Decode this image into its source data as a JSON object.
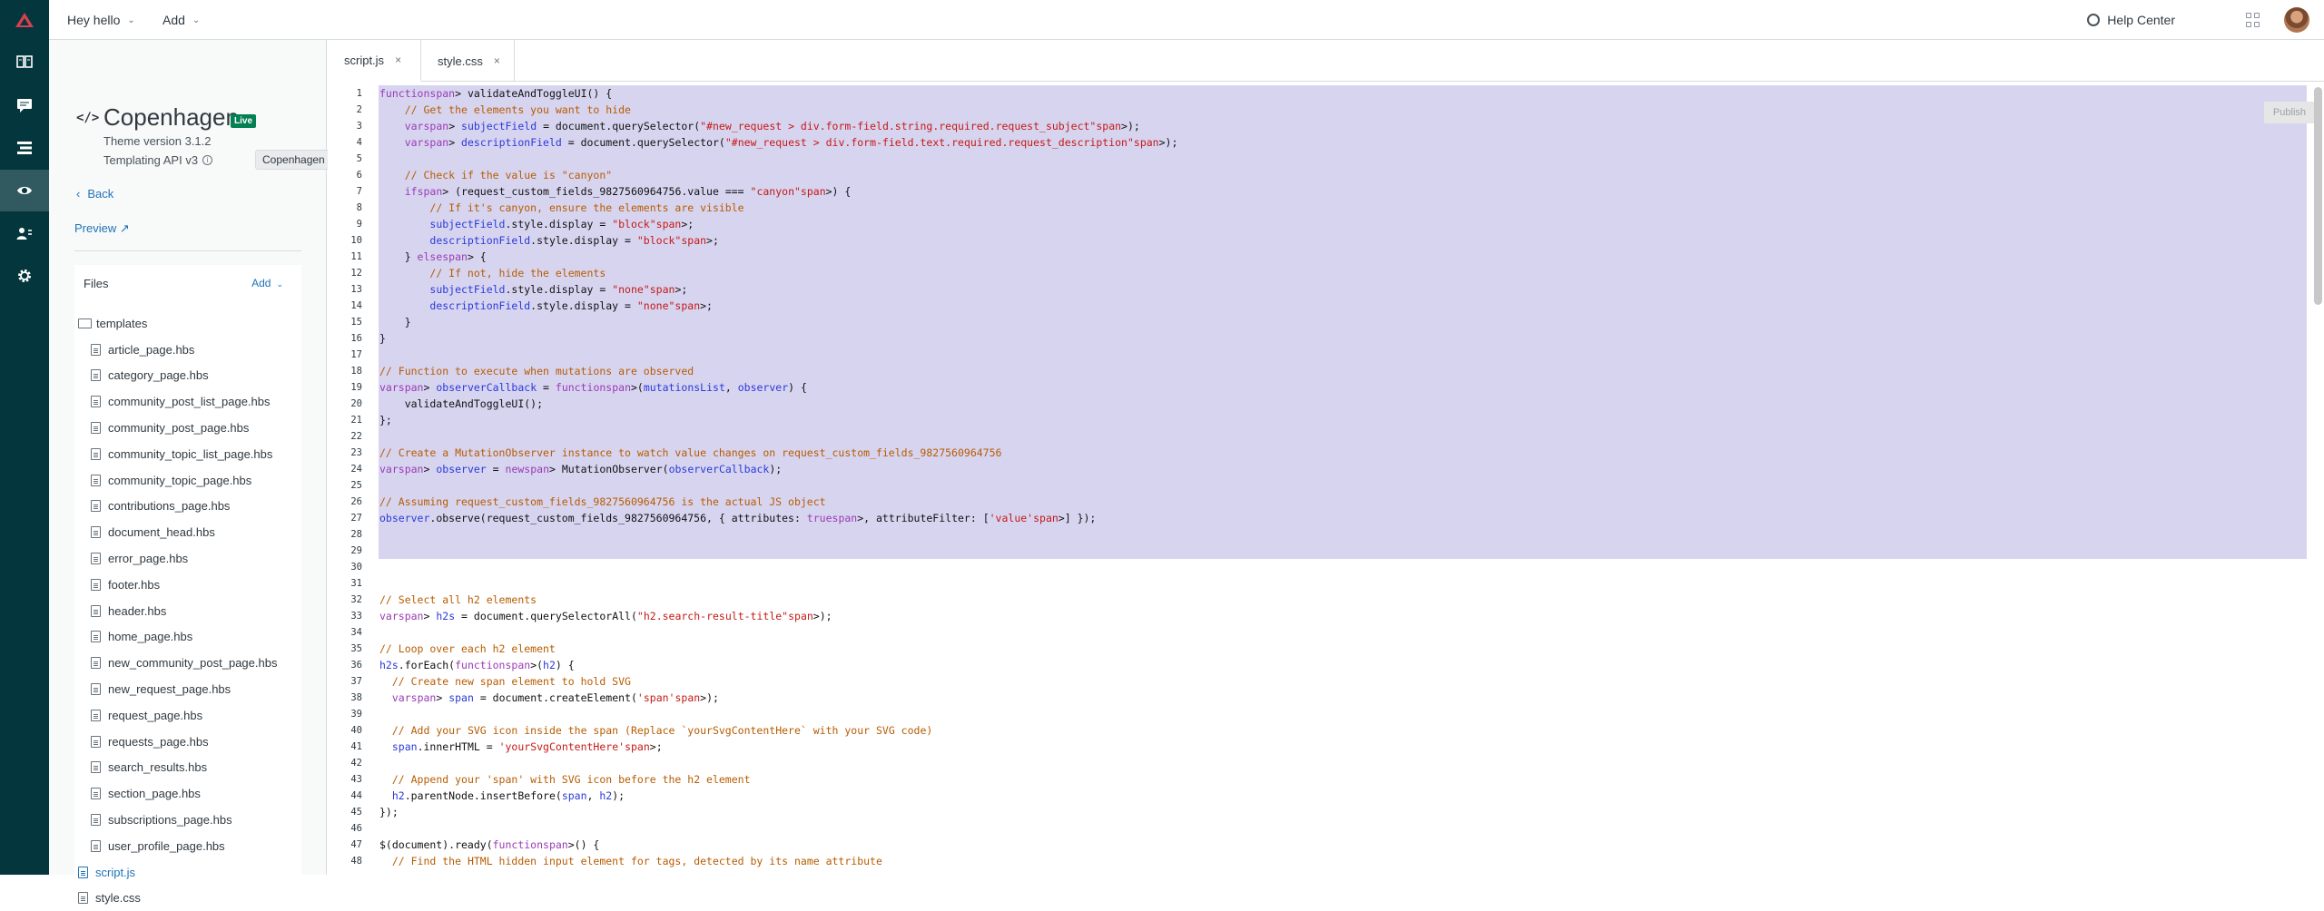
{
  "topbar": {
    "greeting": "Hey hello",
    "add": "Add",
    "help": "Help Center"
  },
  "rail": {
    "items": [
      "guide-icon",
      "chat-icon",
      "list-icon",
      "eye-icon",
      "users-icon",
      "gear-icon"
    ]
  },
  "theme": {
    "name": "Copenhagen",
    "status": "Live",
    "version": "Theme version 3.1.2",
    "api": "Templating API v3",
    "back": "Back",
    "preview": "Preview",
    "tooltip": "Copenhagen"
  },
  "files": {
    "title": "Files",
    "add": "Add",
    "folder": "templates",
    "templates": [
      "article_page.hbs",
      "category_page.hbs",
      "community_post_list_page.hbs",
      "community_post_page.hbs",
      "community_topic_list_page.hbs",
      "community_topic_page.hbs",
      "contributions_page.hbs",
      "document_head.hbs",
      "error_page.hbs",
      "footer.hbs",
      "header.hbs",
      "home_page.hbs",
      "new_community_post_page.hbs",
      "new_request_page.hbs",
      "request_page.hbs",
      "requests_page.hbs",
      "search_results.hbs",
      "section_page.hbs",
      "subscriptions_page.hbs",
      "user_profile_page.hbs"
    ],
    "root": [
      "script.js",
      "style.css"
    ],
    "selected": "script.js"
  },
  "editor": {
    "tabs": [
      {
        "label": "script.js"
      },
      {
        "label": "style.css"
      }
    ],
    "publish": "Publish",
    "line_numbers": [
      "1",
      "2",
      "3",
      "4",
      "5",
      "6",
      "7",
      "8",
      "9",
      "10",
      "11",
      "12",
      "13",
      "14",
      "15",
      "16",
      "17",
      "18",
      "19",
      "20",
      "21",
      "22",
      "23",
      "24",
      "25",
      "26",
      "27",
      "28",
      "29",
      "30",
      "31",
      "32",
      "33",
      "34",
      "35",
      "36",
      "37",
      "38",
      "39",
      "40",
      "41",
      "42",
      "43",
      "44",
      "45",
      "46",
      "47",
      "48"
    ],
    "lines": [
      "function validateAndToggleUI() {",
      "    // Get the elements you want to hide",
      "    var subjectField = document.querySelector(\"#new_request > div.form-field.string.required.request_subject\");",
      "    var descriptionField = document.querySelector(\"#new_request > div.form-field.text.required.request_description\");",
      "",
      "    // Check if the value is \"canyon\"",
      "    if (request_custom_fields_9827560964756.value === \"canyon\") {",
      "        // If it's canyon, ensure the elements are visible",
      "        subjectField.style.display = \"block\";",
      "        descriptionField.style.display = \"block\";",
      "    } else {",
      "        // If not, hide the elements",
      "        subjectField.style.display = \"none\";",
      "        descriptionField.style.display = \"none\";",
      "    }",
      "}",
      "",
      "// Function to execute when mutations are observed",
      "var observerCallback = function(mutationsList, observer) {",
      "    validateAndToggleUI();",
      "};",
      "",
      "// Create a MutationObserver instance to watch value changes on request_custom_fields_9827560964756",
      "var observer = new MutationObserver(observerCallback);",
      "",
      "// Assuming request_custom_fields_9827560964756 is the actual JS object",
      "observer.observe(request_custom_fields_9827560964756, { attributes: true, attributeFilter: ['value'] });",
      "",
      "",
      "",
      "",
      "// Select all h2 elements",
      "var h2s = document.querySelectorAll(\"h2.search-result-title\");",
      "",
      "// Loop over each h2 element",
      "h2s.forEach(function(h2) {",
      "  // Create new span element to hold SVG",
      "  var span = document.createElement('span');",
      "",
      "  // Add your SVG icon inside the span (Replace `yourSvgContentHere` with your SVG code)",
      "  span.innerHTML = 'yourSvgContentHere';",
      "",
      "  // Append your 'span' with SVG icon before the h2 element",
      "  h2.parentNode.insertBefore(span, h2);",
      "});",
      "",
      "$(document).ready(function() {",
      "  // Find the HTML hidden input element for tags, detected by its name attribute"
    ]
  }
}
